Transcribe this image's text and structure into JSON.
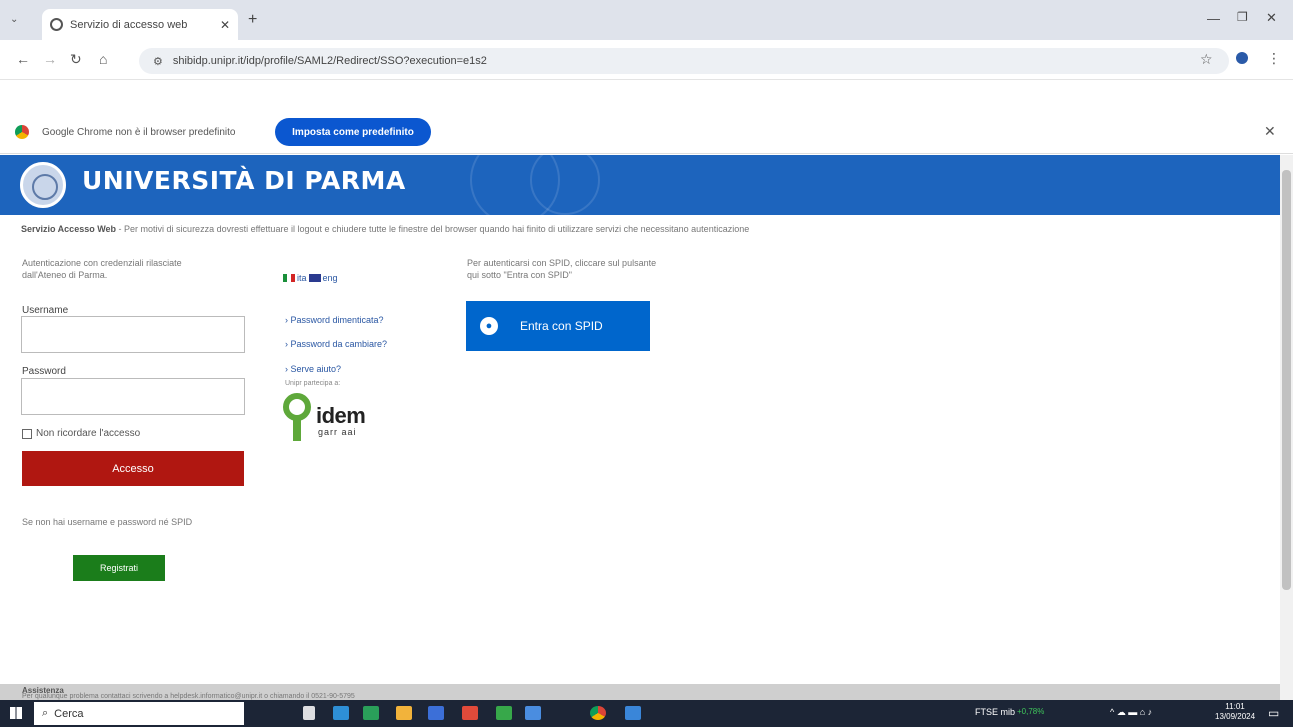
{
  "browser": {
    "tab_title": "Servizio di accesso web",
    "url": "shibidp.unipr.it/idp/profile/SAML2/Redirect/SSO?execution=e1s2",
    "infobar_text": "Google Chrome non è il browser predefinito",
    "set_default_label": "Imposta come predefinito"
  },
  "page": {
    "brand": "UNIVERSITÀ DI PARMA",
    "notice_title": "Servizio Accesso Web",
    "notice_text": " - Per motivi di sicurezza dovresti effettuare il logout e chiudere tutte le finestre del browser quando hai finito di utilizzare servizi che necessitano autenticazione",
    "auth_note": "Autenticazione con credenziali rilasciate dall'Ateneo di Parma.",
    "username_label": "Username",
    "password_label": "Password",
    "remember_label": "Non ricordare l'accesso",
    "login_label": "Accesso",
    "register_note": "Se non hai username e password né SPID",
    "register_label": "Registrati",
    "lang_it": "ita",
    "lang_en": "eng",
    "forgot_link": "› Password dimenticata?",
    "change_link": "› Password da cambiare?",
    "help_link": "› Serve aiuto?",
    "idem_note": "Unipr partecipa a:",
    "idem_text": "idem",
    "idem_sub": "garr aai",
    "spid_note": "Per autenticarsi con SPID, cliccare sul pulsante qui sotto \"Entra con SPID\"",
    "spid_label": "Entra con SPID",
    "footer_title": "Assistenza",
    "footer_text": "Per qualunque problema contattaci scrivendo a helpdesk.informatico@unipr.it o chiamando il 0521-90-5795"
  },
  "taskbar": {
    "search_placeholder": "Cerca",
    "tray_label": "FTSE mib",
    "tray_value": "+0,78%",
    "time": "11:01",
    "date": "13/09/2024"
  },
  "colors": {
    "banner": "#1d64bd",
    "login_button": "#b01711",
    "register_button": "#1b7d1b",
    "spid_button": "#0066cc"
  }
}
